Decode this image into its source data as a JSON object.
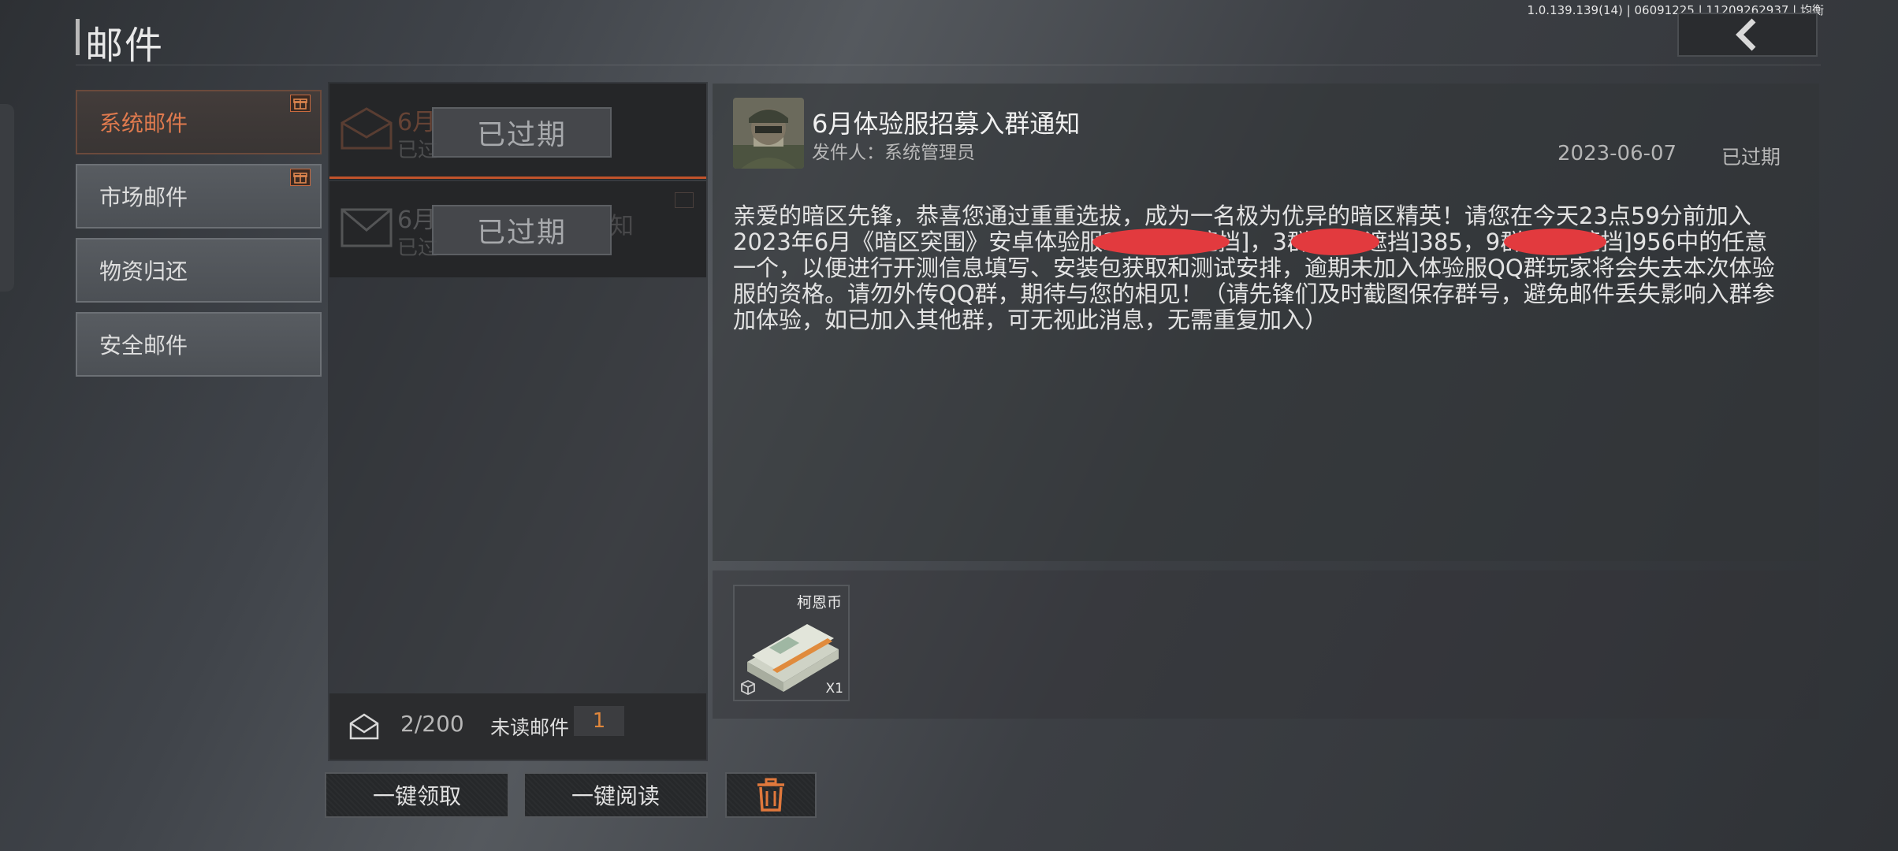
{
  "header": {
    "title": "邮件",
    "version": "1.0.139.139(14) | 06091225 | 11209262937 | 均衡"
  },
  "categories": [
    {
      "label": "系统邮件",
      "active": true,
      "has_gift": true
    },
    {
      "label": "市场邮件",
      "active": false,
      "has_gift": true
    },
    {
      "label": "物资归还",
      "active": false,
      "has_gift": false
    },
    {
      "label": "安全邮件",
      "active": false,
      "has_gift": false
    }
  ],
  "mail_list": {
    "items": [
      {
        "status": "已过期",
        "ghost_title": "6月",
        "ghost_sub": "已过",
        "ghost_tail": ""
      },
      {
        "status": "已过期",
        "ghost_title": "6月",
        "ghost_sub": "已过",
        "ghost_tail": "知"
      }
    ],
    "count": "2/200",
    "unread_label": "未读邮件",
    "unread_count": "1"
  },
  "actions": {
    "claim_all": "一键领取",
    "read_all": "一键阅读",
    "delete_icon": "trash-icon"
  },
  "detail": {
    "title": "6月体验服招募入群通知",
    "sender": "发件人：系统管理员",
    "date": "2023-06-07",
    "status": "已过期",
    "body": "亲爱的暗区先锋，恭喜您通过重重选拔，成为一名极为优异的暗区精英！请您在今天23点59分前加入2023年6月《暗区突围》安卓体验服2群：[已遮挡]，3群：[已遮挡]385，9群：[已遮挡]956中的任意一个，以便进行开测信息填写、安装包获取和测试安排，逾期未加入体验服QQ群玩家将会失去本次体验服的资格。请勿外传QQ群，期待与您的相见！（请先锋们及时截图保存群号，避免邮件丢失影响入群参加体验，如已加入其他群，可无视此消息，无需重复加入）"
  },
  "reward": {
    "name": "柯恩币",
    "quantity": "X1",
    "icon": "cash-stack-icon"
  },
  "colors": {
    "accent_orange": "#e07a4e",
    "unread_orange": "#e0873c",
    "redaction_red": "#e23a3e",
    "selected_line": "#c2532b"
  }
}
